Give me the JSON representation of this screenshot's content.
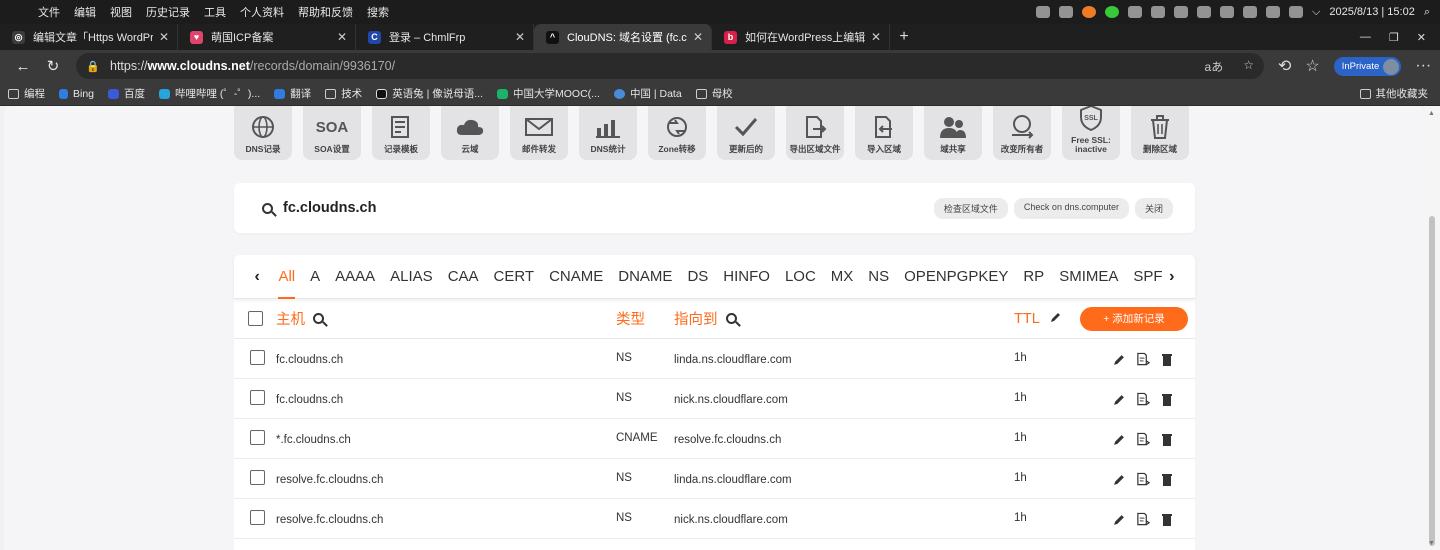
{
  "menubar": {
    "items": [
      "文件",
      "编辑",
      "视图",
      "历史记录",
      "工具",
      "个人资料",
      "帮助和反馈",
      "搜索"
    ],
    "datetime": "2025/8/13 | 15:02"
  },
  "tabs": [
    {
      "title": "编辑文章「Https WordPress」",
      "color": "#3c3c3c",
      "glyph": "◎"
    },
    {
      "title": "萌国ICP备案",
      "color": "#e0436b",
      "glyph": "♥"
    },
    {
      "title": "登录 – ChmlFrp",
      "color": "#2247a8",
      "glyph": "C"
    },
    {
      "title": "ClouDNS: 域名设置 (fc.cloudns.ch)",
      "color": "#111111",
      "glyph": "^",
      "active": true
    },
    {
      "title": "如何在WordPress上编辑个人资料",
      "color": "#d9204b",
      "glyph": "b"
    }
  ],
  "address": {
    "scheme": "https://",
    "host": "www.cloudns.net",
    "path": "/records/domain/9936170/",
    "inprivate": "InPrivate"
  },
  "bookmarks": {
    "items": [
      "编程",
      "Bing",
      "百度",
      "哔哩哔哩 (゜-゜)...",
      "翻译",
      "技术",
      "英语兔 | 像说母语...",
      "中国大学MOOC(...",
      "中国 | Data",
      "母校"
    ],
    "other": "其他收藏夹"
  },
  "toolbar": [
    {
      "label": "DNS记录",
      "icon": "globe-icon",
      "glyph": "🌐"
    },
    {
      "label": "SOA设置",
      "icon": "soa-icon",
      "glyph": "SOA"
    },
    {
      "label": "记录模板",
      "icon": "template-icon",
      "glyph": "▤"
    },
    {
      "label": "云域",
      "icon": "cloud-icon",
      "glyph": "☁"
    },
    {
      "label": "邮件转发",
      "icon": "mail-icon",
      "glyph": "✉"
    },
    {
      "label": "DNS统计",
      "icon": "stats-icon",
      "glyph": "▥"
    },
    {
      "label": "Zone转移",
      "icon": "transfer-icon",
      "glyph": "⟳"
    },
    {
      "label": "更新后的",
      "icon": "check-icon",
      "glyph": "✓"
    },
    {
      "label": "导出区域文件",
      "icon": "export-icon",
      "glyph": "⇥"
    },
    {
      "label": "导入区域",
      "icon": "import-icon",
      "glyph": "⇤"
    },
    {
      "label": "域共享",
      "icon": "share-icon",
      "glyph": "👥"
    },
    {
      "label": "改变所有者",
      "icon": "owner-icon",
      "glyph": "⇆"
    },
    {
      "label": "Free SSL: inactive",
      "icon": "ssl-icon",
      "glyph": "SSL"
    },
    {
      "label": "删除区域",
      "icon": "trash-icon",
      "glyph": "🗑"
    }
  ],
  "zone": {
    "name": "fc.cloudns.ch",
    "actions": [
      "检查区域文件",
      "Check on dns.computer",
      "关闭"
    ]
  },
  "record_types": [
    "All",
    "A",
    "AAAA",
    "ALIAS",
    "CAA",
    "CERT",
    "CNAME",
    "DNAME",
    "DS",
    "HINFO",
    "LOC",
    "MX",
    "NS",
    "OPENPGPKEY",
    "RP",
    "SMIMEA",
    "SPF"
  ],
  "table": {
    "headers": {
      "host": "主机",
      "type": "类型",
      "points_to": "指向到",
      "ttl": "TTL"
    },
    "add_label": "+ 添加新记录",
    "rows": [
      {
        "host": "fc.cloudns.ch",
        "type": "NS",
        "points_to": "linda.ns.cloudflare.com",
        "ttl": "1h"
      },
      {
        "host": "fc.cloudns.ch",
        "type": "NS",
        "points_to": "nick.ns.cloudflare.com",
        "ttl": "1h"
      },
      {
        "host": "*.fc.cloudns.ch",
        "type": "CNAME",
        "points_to": "resolve.fc.cloudns.ch",
        "ttl": "1h"
      },
      {
        "host": "resolve.fc.cloudns.ch",
        "type": "NS",
        "points_to": "linda.ns.cloudflare.com",
        "ttl": "1h"
      },
      {
        "host": "resolve.fc.cloudns.ch",
        "type": "NS",
        "points_to": "nick.ns.cloudflare.com",
        "ttl": "1h"
      }
    ]
  }
}
